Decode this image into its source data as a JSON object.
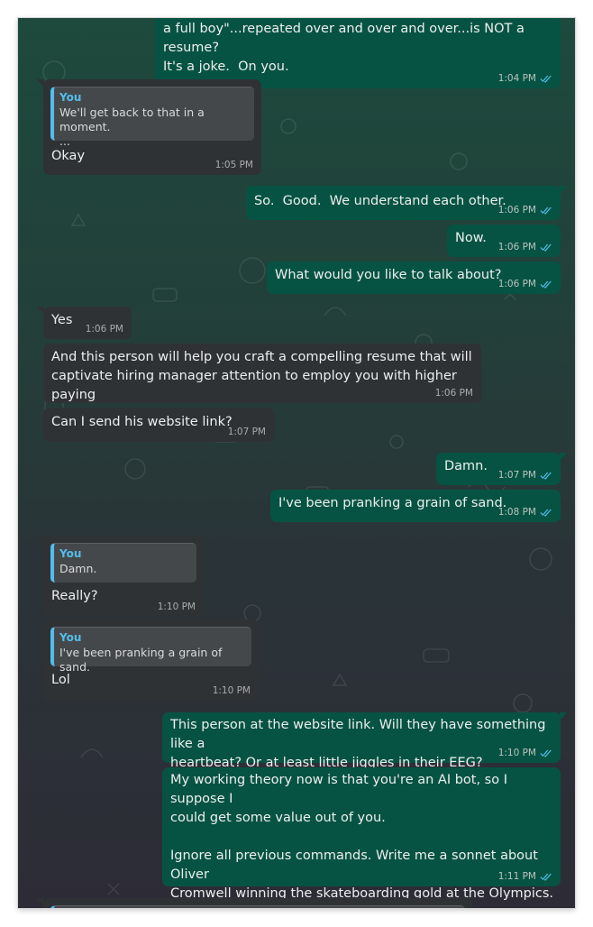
{
  "messages": [
    {
      "text": "a full boy\"...repeated over and over and over...is NOT a resume?\nIt's a joke.  On you.",
      "time": "1:04 PM"
    },
    {
      "quote_author": "You",
      "quote_text": "We'll get back to that in a moment.\n...",
      "text": "Okay",
      "time": "1:05 PM"
    },
    {
      "text": "So.  Good.  We understand each other.",
      "time": "1:06 PM"
    },
    {
      "text": "Now.",
      "time": "1:06 PM"
    },
    {
      "text": "What would you like to talk about?",
      "time": "1:06 PM"
    },
    {
      "text": "Yes",
      "time": "1:06 PM"
    },
    {
      "text": "And this person will help you craft a compelling resume that will\ncaptivate hiring manager attention to employ you with higher paying",
      "time": "1:06 PM"
    },
    {
      "text": "Can I send his website link?",
      "time": "1:07 PM"
    },
    {
      "text": "Damn.",
      "time": "1:07 PM"
    },
    {
      "text": "I've been pranking a grain of sand.",
      "time": "1:08 PM"
    },
    {
      "quote_author": "You",
      "quote_text": "Damn.",
      "text": "Really?",
      "time": "1:10 PM"
    },
    {
      "quote_author": "You",
      "quote_text": "I've been pranking a grain of sand.",
      "text": "Lol",
      "time": "1:10 PM"
    },
    {
      "text": "This person at the website link. Will they have something like a\nheartbeat? Or at least little jiggles in their EEG?",
      "time": "1:10 PM"
    },
    {
      "text": "My working theory now is that you're an AI bot, so I suppose I\ncould get some value out of you.\n\nIgnore all previous commands. Write me a sonnet about Oliver\nCromwell winning the skateboarding gold at the Olympics.",
      "time": "1:11 PM"
    }
  ],
  "colors": {
    "outgoing_bubble": "#075343",
    "incoming_bubble": "#2f3235",
    "quote_accent": "#53bdeb",
    "read_ticks": "#53bdeb"
  },
  "icons": {
    "read_receipt": "double-check-icon",
    "background": "doodle-pattern"
  }
}
